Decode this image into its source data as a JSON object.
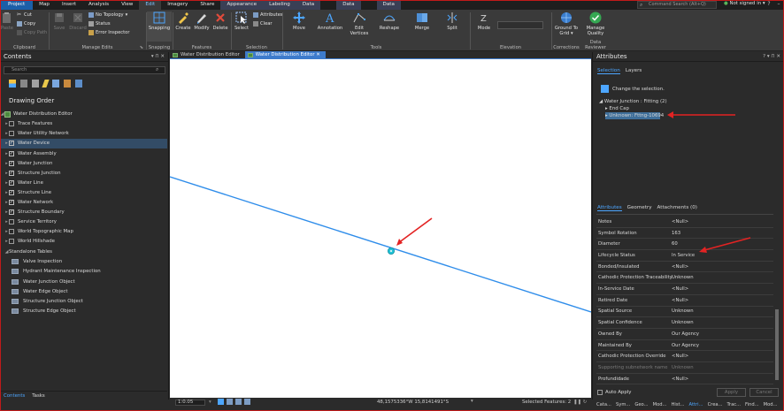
{
  "ribbon_tabs": [
    "Project",
    "Map",
    "Insert",
    "Analysis",
    "View",
    "Edit",
    "Imagery",
    "Share",
    "Appearance",
    "Labeling",
    "Data",
    "Data",
    "Data"
  ],
  "ribbon_active": "Edit",
  "search_placeholder": "Command Search (Alt+Q)",
  "signin": "Not signed in ▾",
  "clipboard": {
    "cut": "Cut",
    "copy": "Copy",
    "copy_path": "Copy Path",
    "paste": "Paste",
    "label": "Clipboard"
  },
  "manage_edits": {
    "save": "Save",
    "discard": "Discard",
    "topology": "No Topology",
    "status": "Status",
    "error_inspector": "Error Inspector",
    "label": "Manage Edits"
  },
  "snapping": {
    "btn": "Snapping",
    "label": "Snapping"
  },
  "features": {
    "create": "Create",
    "modify": "Modify",
    "delete": "Delete",
    "label": "Features"
  },
  "selection": {
    "select": "Select",
    "attributes": "Attributes",
    "clear": "Clear",
    "label": "Selection"
  },
  "tools": {
    "move": "Move",
    "annotation": "Annotation",
    "edit_vertices": "Edit Vertices",
    "reshape": "Reshape",
    "merge": "Merge",
    "split": "Split",
    "label": "Tools"
  },
  "elevation": {
    "mode": "Mode",
    "label": "Elevation"
  },
  "corrections": {
    "ground": "Ground To Grid ▾",
    "label": "Corrections"
  },
  "data_reviewer": {
    "manage": "Manage Quality",
    "label": "Data Reviewer"
  },
  "contents": {
    "title": "Contents",
    "search_placeholder": "Search",
    "drawing_order": "Drawing Order",
    "map_name": "Water Distribution Editor",
    "layers": [
      {
        "name": "Trace Features",
        "checked": false,
        "selected": false
      },
      {
        "name": "Water Utility Network",
        "checked": false,
        "selected": false
      },
      {
        "name": "Water Device",
        "checked": true,
        "selected": true
      },
      {
        "name": "Water Assembly",
        "checked": true,
        "selected": false
      },
      {
        "name": "Water Junction",
        "checked": true,
        "selected": false
      },
      {
        "name": "Structure Junction",
        "checked": true,
        "selected": false
      },
      {
        "name": "Water Line",
        "checked": true,
        "selected": false
      },
      {
        "name": "Structure Line",
        "checked": true,
        "selected": false
      },
      {
        "name": "Water Network",
        "checked": true,
        "selected": false
      },
      {
        "name": "Structure Boundary",
        "checked": true,
        "selected": false
      },
      {
        "name": "Service Territory",
        "checked": false,
        "selected": false
      },
      {
        "name": "World Topographic Map",
        "checked": false,
        "selected": false
      },
      {
        "name": "World Hillshade",
        "checked": false,
        "selected": false
      }
    ],
    "standalone_header": "Standalone Tables",
    "tables": [
      "Valve Inspection",
      "Hydrant Maintenance Inspection",
      "Water Junction Object",
      "Water Edge Object",
      "Structure Junction Object",
      "Structure Edge Object"
    ],
    "bottom_tabs": [
      "Contents",
      "Tasks"
    ]
  },
  "map_tabs": [
    "Water Distribution Editor",
    "Water Distribution Editor"
  ],
  "map_status": {
    "scale": "1:0.05",
    "coords": "48,1575336°W 15,8141491°S",
    "selected": "Selected Features: 2"
  },
  "attributes": {
    "title": "Attributes",
    "tabs": [
      "Selection",
      "Layers"
    ],
    "change_selection": "Change the selection.",
    "tree": {
      "root": "Water Junction : Fitting (2)",
      "child1": "End Cap",
      "child2": "Unknown: Fttng-10694"
    },
    "detail_tabs": [
      "Attributes",
      "Geometry",
      "Attachments (0)"
    ],
    "rows": [
      {
        "k": "Notes",
        "v": "<Null>"
      },
      {
        "k": "Symbol Rotation",
        "v": "163"
      },
      {
        "k": "Diameter",
        "v": "60"
      },
      {
        "k": "Lifecycle Status",
        "v": "In Service"
      },
      {
        "k": "Bonded/Insulated",
        "v": "<Null>"
      },
      {
        "k": "Cathodic Protection Traceability",
        "v": "Unknown"
      },
      {
        "k": "In-Service Date",
        "v": "<Null>"
      },
      {
        "k": "Retired Date",
        "v": "<Null>"
      },
      {
        "k": "Spatial Source",
        "v": "Unknown"
      },
      {
        "k": "Spatial Confidence",
        "v": "Unknown"
      },
      {
        "k": "Owned By",
        "v": "Our Agency"
      },
      {
        "k": "Maintained By",
        "v": "Our Agency"
      },
      {
        "k": "Cathodic Protection Override",
        "v": "<Null>"
      },
      {
        "k": "Supporting subnetwork name",
        "v": "Unknown"
      },
      {
        "k": "Profundidade",
        "v": "<Null>"
      }
    ],
    "auto_apply": "Auto Apply",
    "apply": "Apply",
    "cancel": "Cancel",
    "bottom_tabs": [
      "Cata...",
      "Sym...",
      "Geo...",
      "Mod...",
      "Hist...",
      "Attri...",
      "Crea...",
      "Trac...",
      "Find...",
      "Mod..."
    ]
  },
  "colors": {
    "accent": "#4da6ff",
    "line": "#2f8dea",
    "point": "#22c3d6",
    "arrow": "#e32323"
  }
}
